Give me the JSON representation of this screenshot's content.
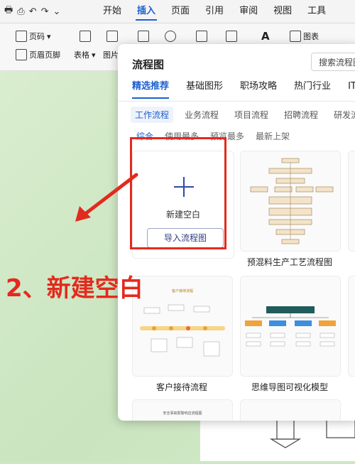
{
  "menubar": {
    "tabs": [
      "开始",
      "插入",
      "页面",
      "引用",
      "审阅",
      "视图",
      "工具"
    ],
    "active_tab": "插入"
  },
  "ribbon": {
    "page_number": "页码",
    "header_footer": "页眉页脚",
    "table": "表格",
    "picture": "图片",
    "chart": "图表",
    "chevron": "▾"
  },
  "dialog": {
    "title": "流程图",
    "search_placeholder": "搜索流程图",
    "main_tabs": [
      "精选推荐",
      "基础图形",
      "职场攻略",
      "热门行业",
      "IT互联网"
    ],
    "sub_tabs": [
      "工作流程",
      "业务流程",
      "项目流程",
      "招聘流程",
      "研发流程"
    ],
    "sort_tabs": [
      "综合",
      "使用最多",
      "预览最多",
      "最新上架"
    ],
    "new_blank": "新建空白",
    "import_button": "导入流程图",
    "templates": [
      {
        "name": "预混料生产工艺流程图"
      },
      {
        "name": "客户接待流程"
      },
      {
        "name": "思维导图可视化模型"
      }
    ],
    "thumb_title_1": "客户接待流程",
    "thumb_title_2": "安全事故报警响应流程图"
  },
  "annotation": {
    "text": "2、新建空白",
    "color": "#e32a1e"
  },
  "colors": {
    "accent": "#1d5fd1",
    "annotation_red": "#e32a1e"
  }
}
